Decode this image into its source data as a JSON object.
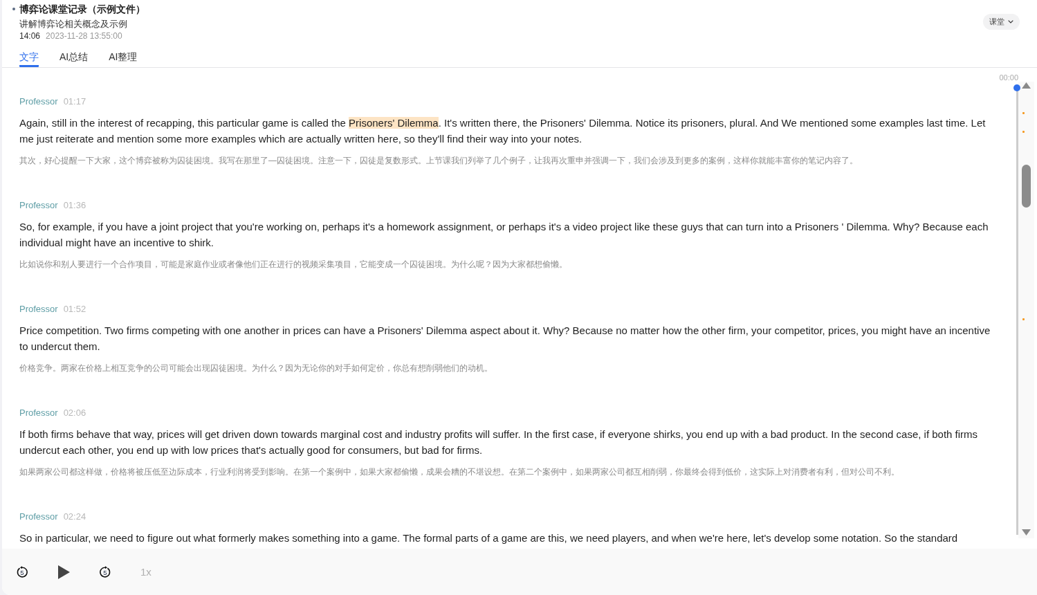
{
  "header": {
    "title": "博弈论课堂记录（示例文件）",
    "subtitle": "讲解博弈论相关概念及示例",
    "duration": "14:06",
    "datetime": "2023-11-28 13:55:00"
  },
  "scene_selector": {
    "label": "课堂"
  },
  "tabs": [
    {
      "label": "文字",
      "selected": true
    },
    {
      "label": "AI总结",
      "selected": false
    },
    {
      "label": "AI整理",
      "selected": false
    }
  ],
  "transcript": [
    {
      "speaker": "Professor",
      "time": "01:17",
      "parts": [
        {
          "text": "Again, still in the interest of recapping, this particular game is called the ",
          "highlighted": false
        },
        {
          "text": "Prisoners' Dilemma",
          "highlighted": true
        },
        {
          "text": ". It's written there, the Prisoners' Dilemma. Notice its prisoners, plural. And We mentioned some examples last time. Let me just reiterate and mention some more examples which are actually written here, so they'll find their way into your notes.",
          "highlighted": false
        }
      ],
      "translation": "其次，好心提醒一下大家，这个博弈被称为囚徒困境。我写在那里了—囚徒困境。注意一下，囚徒是复数形式。上节课我们列举了几个例子，让我再次重申并强调一下，我们会涉及到更多的案例，这样你就能丰富你的笔记内容了。"
    },
    {
      "speaker": "Professor",
      "time": "01:36",
      "parts": [
        {
          "text": "So, for example, if you have a joint project that you're working on, perhaps it's a homework assignment, or perhaps it's a video project like these guys that can turn into a Prisoners ' Dilemma. Why? Because each individual might have an incentive to shirk.",
          "highlighted": false
        }
      ],
      "translation": "比如说你和别人要进行一个合作项目，可能是家庭作业或者像他们正在进行的视频采集项目，它能变成一个囚徒困境。为什么呢？因为大家都想偷懒。"
    },
    {
      "speaker": "Professor",
      "time": "01:52",
      "parts": [
        {
          "text": "Price competition. Two firms competing with one another in prices can have a Prisoners' Dilemma aspect about it. Why? Because no matter how the other firm, your competitor, prices, you might have an incentive to undercut them.",
          "highlighted": false
        }
      ],
      "translation": "价格竞争。两家在价格上相互竞争的公司可能会出现囚徒困境。为什么？因为无论你的对手如何定价，你总有想削弱他们的动机。"
    },
    {
      "speaker": "Professor",
      "time": "02:06",
      "parts": [
        {
          "text": "If both firms behave that way, prices will get driven down towards marginal cost and industry profits will suffer. In the first case, if everyone shirks, you end up with a bad product. In the second case, if both firms undercut each other, you end up with low prices that's actually good for consumers, but bad for firms.",
          "highlighted": false
        }
      ],
      "translation": "如果两家公司都这样做，价格将被压低至边际成本，行业利润将受到影响。在第一个案例中，如果大家都偷懒，成果会糟的不堪设想。在第二个案例中，如果两家公司都互相削弱，你最终会得到低价，这实际上对消费者有利，但对公司不利。"
    },
    {
      "speaker": "Professor",
      "time": "02:24",
      "parts": [
        {
          "text": "So in particular, we need to figure out what formerly makes something into a game. The formal parts of a game are this, we need players, and when we're here, let's develop some notation. So the standard",
          "highlighted": false
        }
      ]
    }
  ],
  "timeline": {
    "time_label": "00:00",
    "level": 0
  },
  "player": {
    "skip_back": "5",
    "playing": false,
    "skip_forward": "5",
    "speed": "1x"
  }
}
